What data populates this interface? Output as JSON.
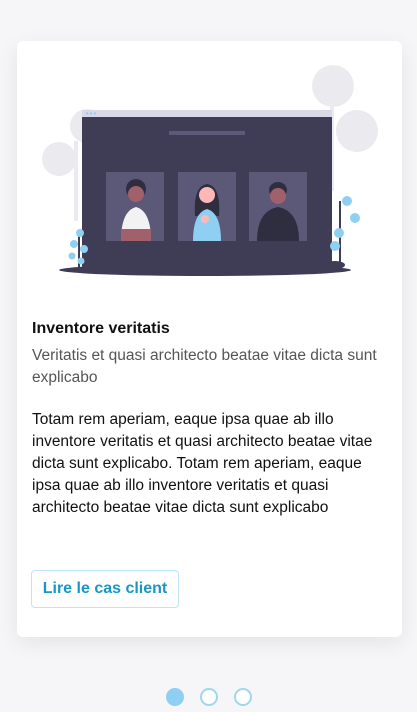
{
  "card": {
    "title": "Inventore veritatis",
    "subtitle": "Veritatis et quasi architecto beatae vitae dicta sunt explicabo",
    "body": "Totam rem aperiam, eaque ipsa quae ab illo inventore veritatis et quasi architecto beatae vitae dicta sunt explicabo. Totam rem aperiam, eaque ipsa quae ab illo inventore veritatis et quasi architecto beatae vitae dicta sunt explicabo",
    "cta_label": "Lire le cas client"
  },
  "carousel": {
    "slide_count": 3,
    "active_index": 0
  },
  "colors": {
    "accent": "#1a96c4",
    "dot_active": "#8fd0f2",
    "screen": "#3f3d56"
  },
  "icons": {
    "illustration": "video-conference-illustration"
  }
}
